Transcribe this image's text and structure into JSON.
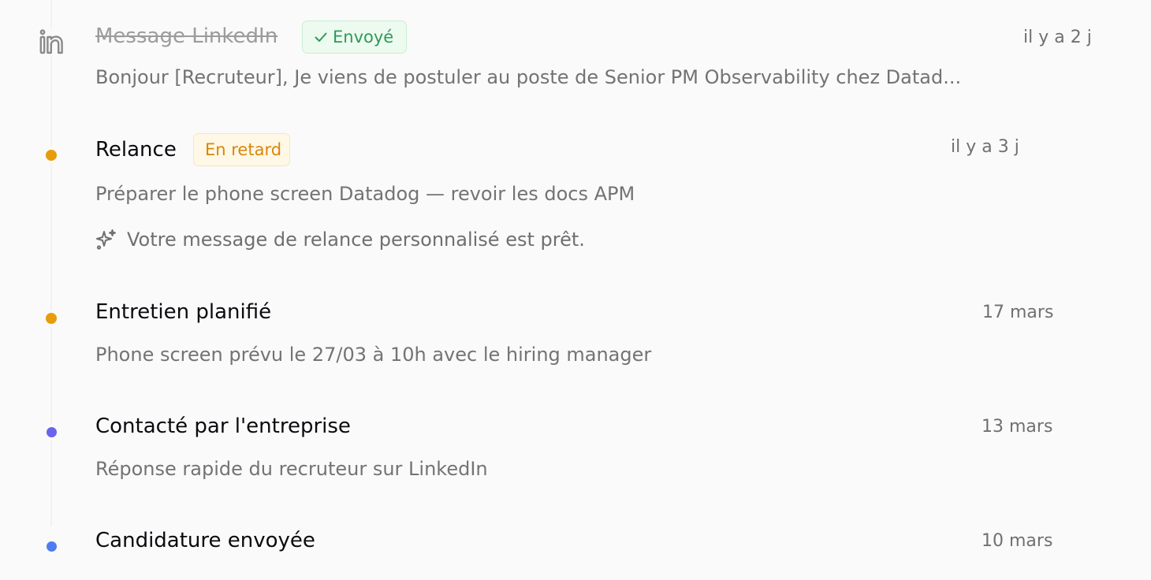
{
  "timeline": {
    "events": [
      {
        "icon": "linkedin-icon",
        "title": "Message LinkedIn",
        "badge": "Envoyé",
        "badge_icon": "check-icon",
        "date": "il y a 2 j",
        "description": "Bonjour [Recruteur], Je viens de postuler au poste de Senior PM Observability chez Datad..."
      },
      {
        "dot_color": "#e79d0b",
        "title": "Relance",
        "badge": "En retard",
        "date": "il y a 3 j",
        "description": "Préparer le phone screen Datadog — revoir les docs APM",
        "ai_icon": "sparkles-icon",
        "ai_message": "Votre message de relance personnalisé est prêt."
      },
      {
        "dot_color": "#e79d0b",
        "title": "Entretien planifié",
        "date": "17 mars",
        "description": "Phone screen prévu le 27/03 à 10h avec le hiring manager"
      },
      {
        "dot_color": "#6a63ef",
        "title": "Contacté par l'entreprise",
        "date": "13 mars",
        "description": "Réponse rapide du recruteur sur LinkedIn"
      },
      {
        "dot_color": "#4f7df0",
        "title": "Candidature envoyée",
        "date": "10 mars"
      }
    ]
  },
  "colors": {
    "sent_green": "#2f9a58",
    "late_amber": "#d8860b",
    "rail": "#f1f1f3"
  }
}
